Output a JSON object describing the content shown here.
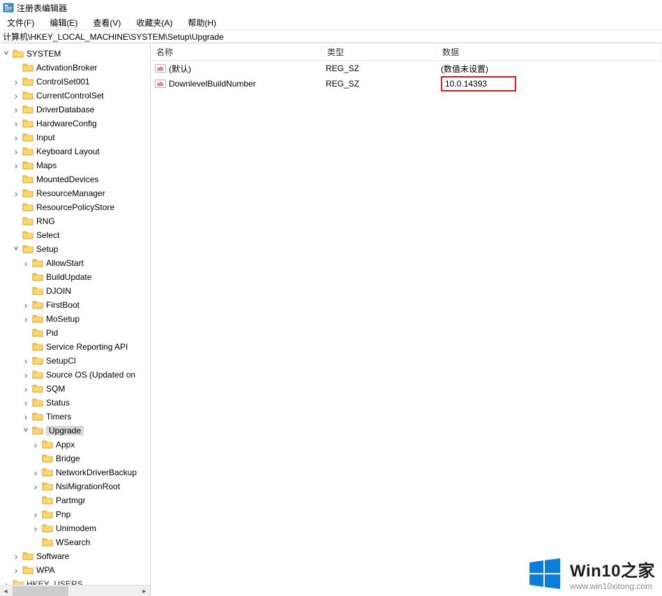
{
  "window": {
    "title": "注册表编辑器"
  },
  "menu": {
    "file": "文件(F)",
    "edit": "编辑(E)",
    "view": "查看(V)",
    "favorites": "收藏夹(A)",
    "help": "帮助(H)"
  },
  "address": {
    "path": "计算机\\HKEY_LOCAL_MACHINE\\SYSTEM\\Setup\\Upgrade"
  },
  "columns": {
    "name": "名称",
    "type": "类型",
    "data": "数据"
  },
  "values": [
    {
      "name": "(默认)",
      "type": "REG_SZ",
      "data": "(数值未设置)",
      "highlight": false
    },
    {
      "name": "DownlevelBuildNumber",
      "type": "REG_SZ",
      "data": "10.0.14393",
      "highlight": true
    }
  ],
  "tree": [
    {
      "level": 0,
      "label": "SYSTEM",
      "expander": "˅"
    },
    {
      "level": 1,
      "label": "ActivationBroker",
      "expander": ""
    },
    {
      "level": 1,
      "label": "ControlSet001",
      "expander": ">"
    },
    {
      "level": 1,
      "label": "CurrentControlSet",
      "expander": ">"
    },
    {
      "level": 1,
      "label": "DriverDatabase",
      "expander": ">"
    },
    {
      "level": 1,
      "label": "HardwareConfig",
      "expander": ">"
    },
    {
      "level": 1,
      "label": "Input",
      "expander": ">"
    },
    {
      "level": 1,
      "label": "Keyboard Layout",
      "expander": ">"
    },
    {
      "level": 1,
      "label": "Maps",
      "expander": ">"
    },
    {
      "level": 1,
      "label": "MountedDevices",
      "expander": ""
    },
    {
      "level": 1,
      "label": "ResourceManager",
      "expander": ">"
    },
    {
      "level": 1,
      "label": "ResourcePolicyStore",
      "expander": ""
    },
    {
      "level": 1,
      "label": "RNG",
      "expander": ""
    },
    {
      "level": 1,
      "label": "Select",
      "expander": ""
    },
    {
      "level": 1,
      "label": "Setup",
      "expander": "˅"
    },
    {
      "level": 2,
      "label": "AllowStart",
      "expander": ">"
    },
    {
      "level": 2,
      "label": "BuildUpdate",
      "expander": ""
    },
    {
      "level": 2,
      "label": "DJOIN",
      "expander": ""
    },
    {
      "level": 2,
      "label": "FirstBoot",
      "expander": ">"
    },
    {
      "level": 2,
      "label": "MoSetup",
      "expander": ">"
    },
    {
      "level": 2,
      "label": "Pid",
      "expander": ""
    },
    {
      "level": 2,
      "label": "Service Reporting API",
      "expander": ""
    },
    {
      "level": 2,
      "label": "SetupCl",
      "expander": ">"
    },
    {
      "level": 2,
      "label": "Source OS (Updated on",
      "expander": ">"
    },
    {
      "level": 2,
      "label": "SQM",
      "expander": ">"
    },
    {
      "level": 2,
      "label": "Status",
      "expander": ">"
    },
    {
      "level": 2,
      "label": "Timers",
      "expander": ">"
    },
    {
      "level": 2,
      "label": "Upgrade",
      "expander": "˅",
      "selected": true
    },
    {
      "level": 3,
      "label": "Appx",
      "expander": ">"
    },
    {
      "level": 3,
      "label": "Bridge",
      "expander": ""
    },
    {
      "level": 3,
      "label": "NetworkDriverBackup",
      "expander": ">"
    },
    {
      "level": 3,
      "label": "NsiMigrationRoot",
      "expander": ">"
    },
    {
      "level": 3,
      "label": "Partmgr",
      "expander": ""
    },
    {
      "level": 3,
      "label": "Pnp",
      "expander": ">"
    },
    {
      "level": 3,
      "label": "Unimodem",
      "expander": ">"
    },
    {
      "level": 3,
      "label": "WSearch",
      "expander": ""
    },
    {
      "level": 1,
      "label": "Software",
      "expander": ">"
    },
    {
      "level": 1,
      "label": "WPA",
      "expander": ">"
    },
    {
      "level": 0,
      "label": "HKEY_USERS",
      "expander": ">",
      "cut": true
    }
  ],
  "watermark": {
    "title_en": "Win10",
    "title_cn": "之家",
    "url": "www.win10xitong.com"
  }
}
